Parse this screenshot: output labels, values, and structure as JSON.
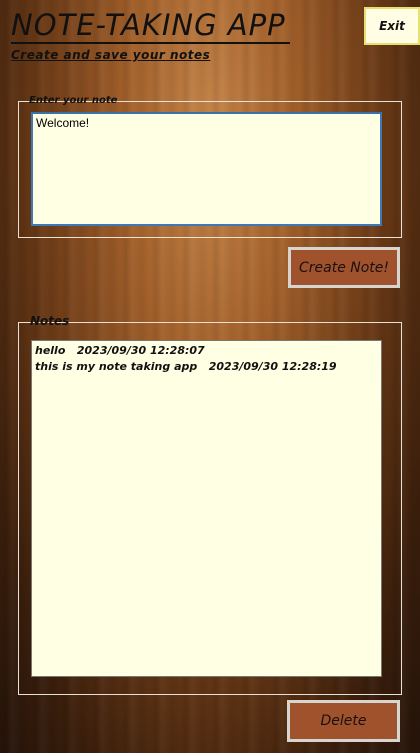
{
  "app": {
    "title": "NOTE-TAKING APP",
    "subtitle": "Create and save your notes",
    "exit_label": "Exit"
  },
  "input_group": {
    "label": "Enter your note",
    "value": "Welcome!"
  },
  "create_button": {
    "label": "Create Note!"
  },
  "notes_group": {
    "label": "Notes",
    "items": [
      "hello   2023/09/30 12:28:07",
      "this is my note taking app   2023/09/30 12:28:19"
    ]
  },
  "delete_button": {
    "label": "Delete"
  },
  "colors": {
    "button_fill": "#a0522d",
    "input_background": "#ffffe3",
    "input_border": "#3b79b8"
  }
}
